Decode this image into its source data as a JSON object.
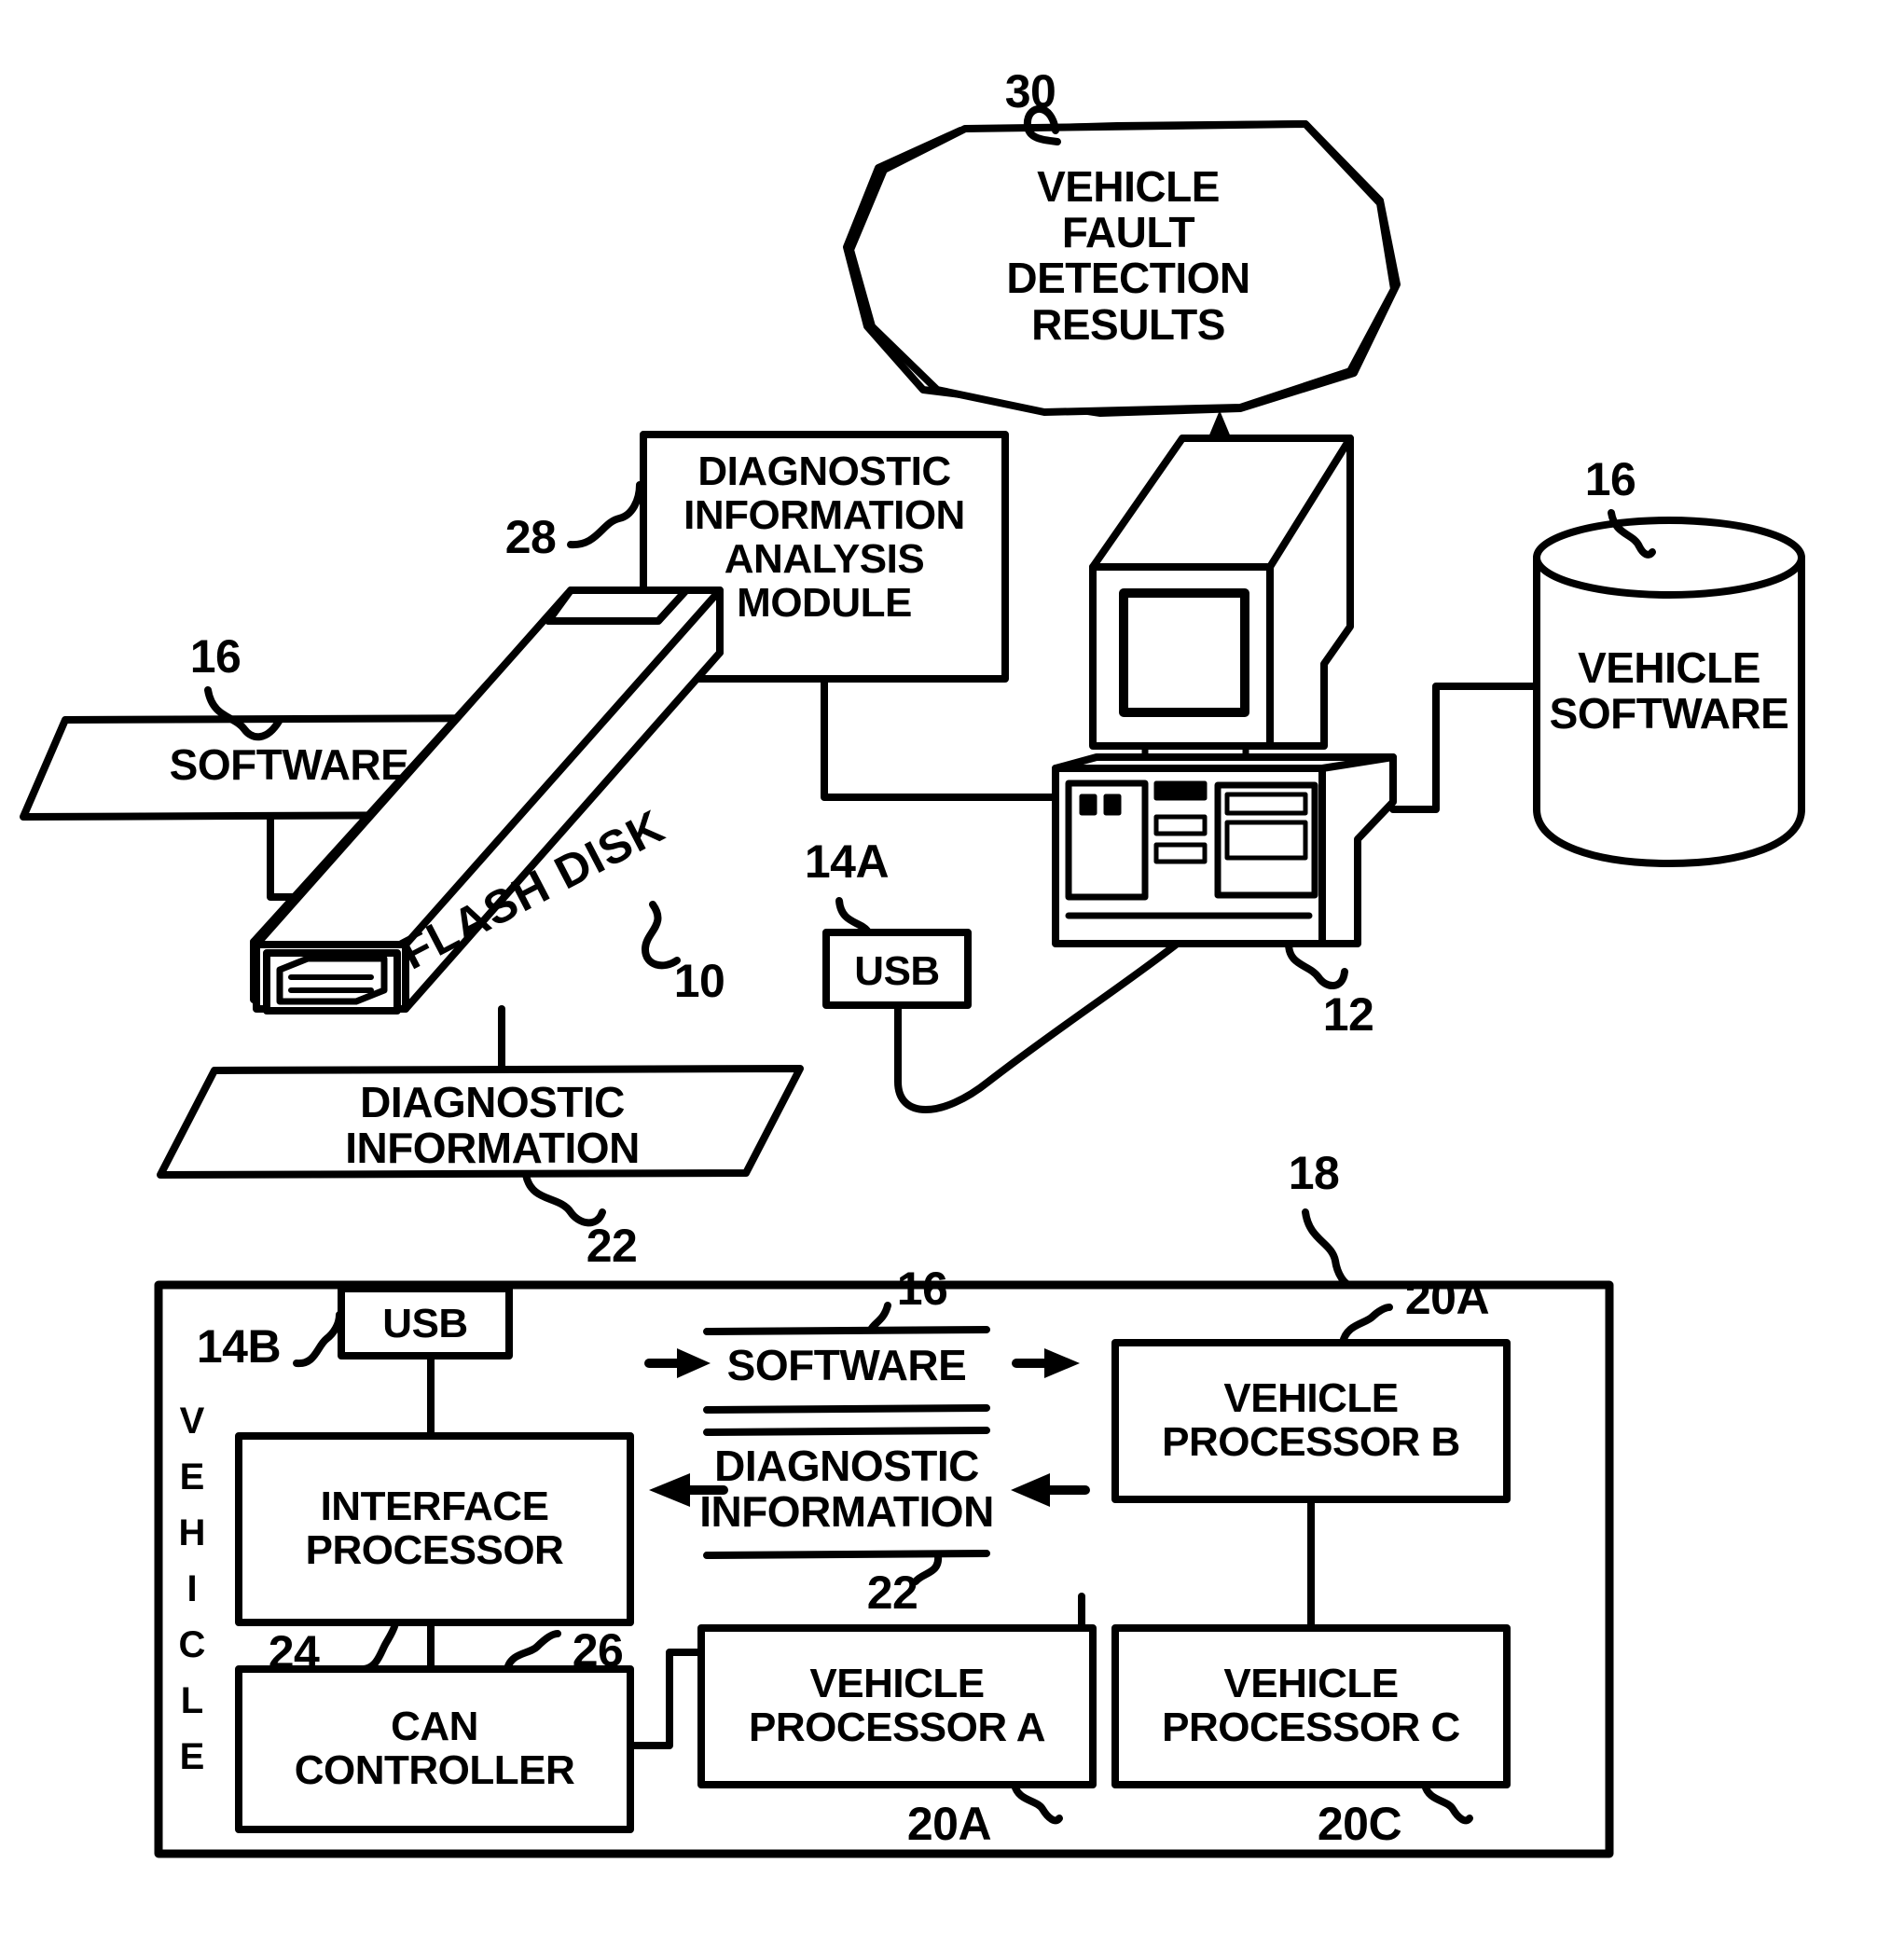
{
  "figure": {
    "type": "patent-block-diagram",
    "background": "#ffffff",
    "stroke": "#000000"
  },
  "cloud": {
    "label": "VEHICLE\nFAULT\nDETECTION\nRESULTS",
    "ref": "30"
  },
  "analysis_module": {
    "label": "DIAGNOSTIC\nINFORMATION\nANALYSIS\nMODULE",
    "ref": "28"
  },
  "software_box": {
    "label": "SOFTWARE",
    "ref": "16"
  },
  "flash_disk": {
    "label": "FLASH DISK",
    "ref": "10"
  },
  "diagnostic_info_box": {
    "label": "DIAGNOSTIC\nINFORMATION",
    "ref": "22"
  },
  "usb_external": {
    "label": "USB",
    "ref": "14A"
  },
  "computer": {
    "ref": "12"
  },
  "vehicle_software_db": {
    "label": "VEHICLE\nSOFTWARE",
    "ref": "16"
  },
  "vehicle": {
    "ref": "18",
    "side_label": "VEHICLE",
    "side_letters": [
      "V",
      "E",
      "H",
      "I",
      "C",
      "L",
      "E"
    ],
    "usb": {
      "label": "USB",
      "ref": "14B"
    },
    "interface_processor": {
      "label": "INTERFACE\nPROCESSOR",
      "ref": "24"
    },
    "can_controller": {
      "label": "CAN\nCONTROLLER",
      "ref": "26"
    },
    "bus": {
      "software_label": "SOFTWARE",
      "software_ref": "16",
      "diagnostic_label": "DIAGNOSTIC\nINFORMATION",
      "diagnostic_ref": "22"
    },
    "processors": [
      {
        "label": "VEHICLE\nPROCESSOR B",
        "ref": "20A"
      },
      {
        "label": "VEHICLE\nPROCESSOR A",
        "ref": "20A"
      },
      {
        "label": "VEHICLE\nPROCESSOR C",
        "ref": "20C"
      }
    ]
  }
}
